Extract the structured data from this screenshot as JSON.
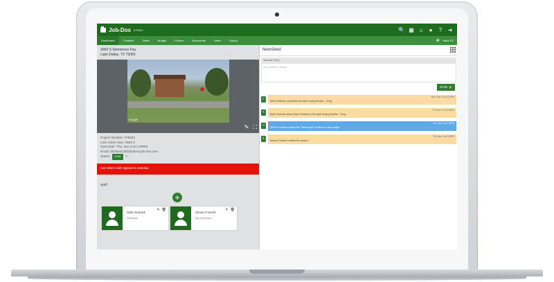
{
  "app": {
    "brand": "Job-Dox",
    "project_number": "#75303"
  },
  "nav": {
    "tabs": [
      "Dashboard",
      "Contacts",
      "Tasks",
      "Budget",
      "Photos",
      "Documents",
      "Video",
      "Drying"
    ],
    "active_tab": "Dashboard",
    "user_label": "Mark S/T"
  },
  "address": {
    "line1": "3000 S Stemmons Fwy",
    "line2": "Lake Dallas, TX 75065"
  },
  "photo": {
    "google_label": "Google"
  },
  "project": {
    "number_line": "Project Number: #75303",
    "last_active_line": "Last Active User: Mark Z",
    "start_date_line": "Start Date: Thu, Nov 9 at 2:29PM",
    "email_line": "Email: dk7504/1303@demo.job-dox.com",
    "status_label": "Status:",
    "status_value": "LEAD"
  },
  "alert": {
    "text": "Get Work Auth signed is overdue"
  },
  "staff": {
    "label": "Staff",
    "members": [
      {
        "name": "Mark Zedwick",
        "role": "Developer"
      },
      {
        "name": "Steven Fossett",
        "role": "App Developer"
      }
    ]
  },
  "newsfeed": {
    "title": "Newsfeed",
    "journal_label": "Journal Entry",
    "journal_placeholder": "Hm, learned, Entry...",
    "save_label": "SAVE",
    "entries": [
      {
        "date": "Mon, Nov 27 at 2:22PM",
        "text": "Mark Zedwick completed the task Drying Monitor - Greg"
      },
      {
        "date": "Fri, Nov 17 at 2:08PM",
        "text": "Mark Zedwick added Mark Zedwick to the task Drying Monitor - Greg"
      },
      {
        "date": "Thu, Nov 9 at 2:29PM",
        "text": "Steven Fossett created the \"New Hood\" creation on this project"
      },
      {
        "date": "Thu, Nov 9 at 2:29PM",
        "text": "Steven Fossett created the project"
      }
    ]
  },
  "colors": {
    "topbar": "#1e6d1e",
    "navbar": "#3d8f3d",
    "alert": "#e3120b",
    "feed_orange": "#fadca0",
    "feed_blue": "#5ea9e6"
  }
}
